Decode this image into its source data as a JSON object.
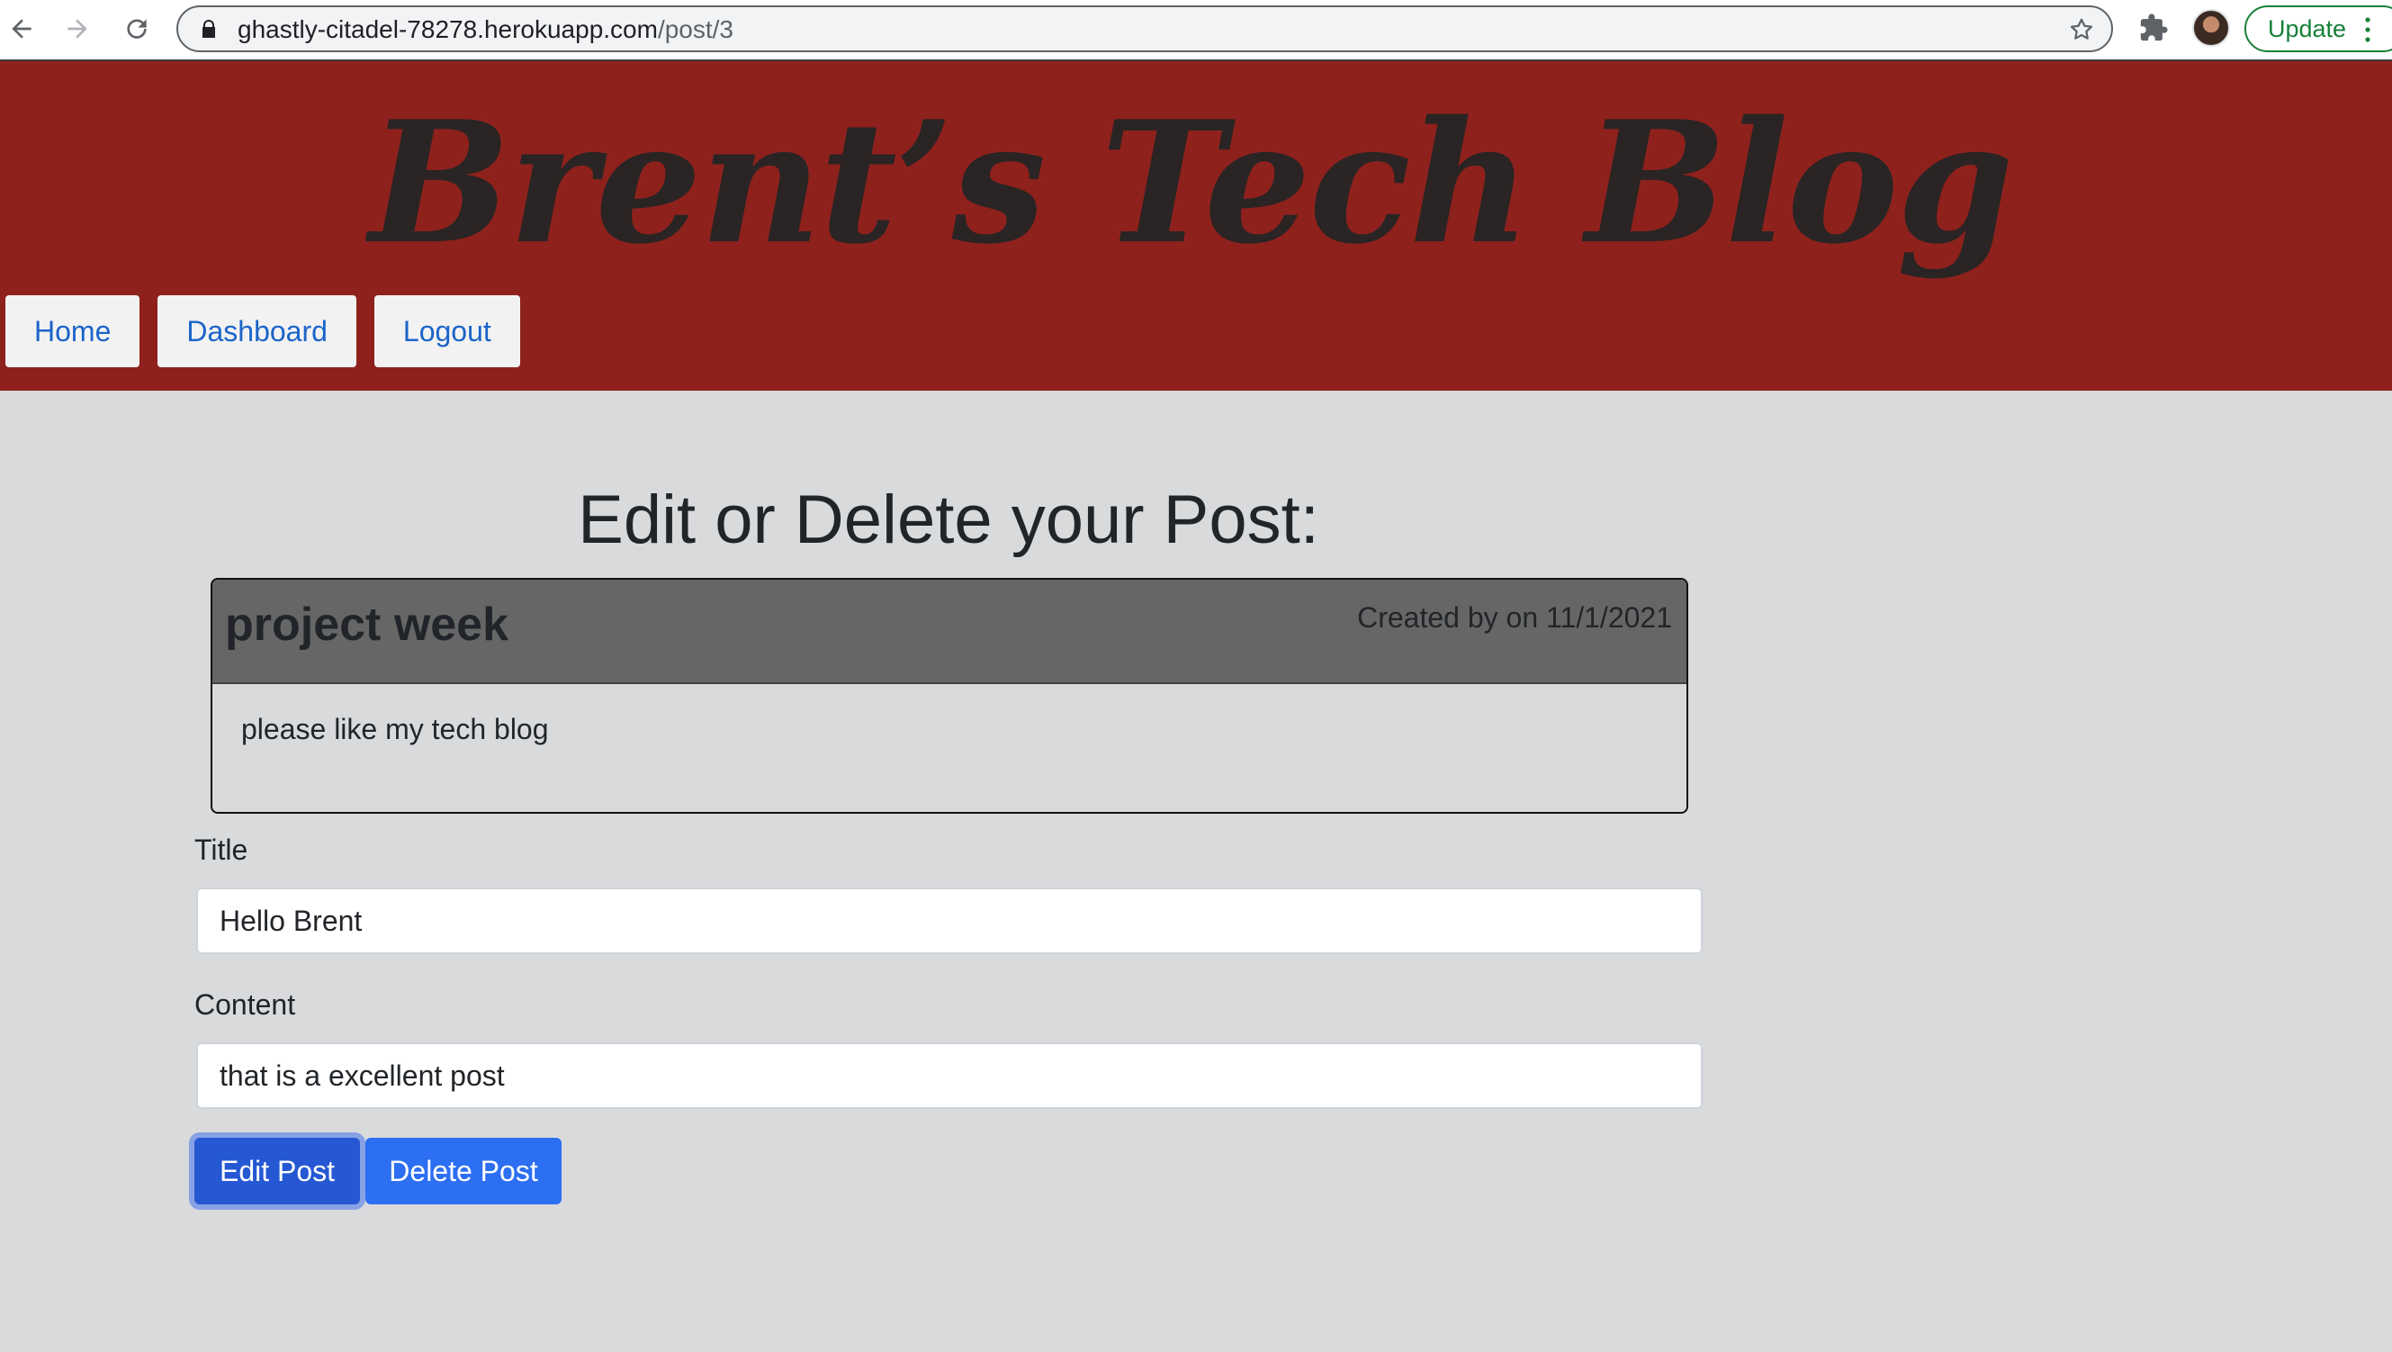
{
  "browser": {
    "url_host": "ghastly-citadel-78278.herokuapp.com",
    "url_path": "/post/3",
    "update_label": "Update"
  },
  "site": {
    "title": "Brent’s Tech Blog",
    "nav": {
      "home": "Home",
      "dashboard": "Dashboard",
      "logout": "Logout"
    }
  },
  "main": {
    "heading": "Edit or Delete your Post:",
    "post": {
      "title": "project week",
      "meta": "Created by on 11/1/2021",
      "body": "please like my tech blog"
    },
    "form": {
      "title_label": "Title",
      "title_value": "Hello Brent",
      "content_label": "Content",
      "content_value": "that is a excellent post",
      "edit_label": "Edit Post",
      "delete_label": "Delete Post"
    }
  },
  "colors": {
    "header_bg": "#8e211c",
    "page_bg": "#d9dadc",
    "card_header_bg": "#666666",
    "button_primary": "#2d6ff2",
    "link": "#1b64c8"
  }
}
